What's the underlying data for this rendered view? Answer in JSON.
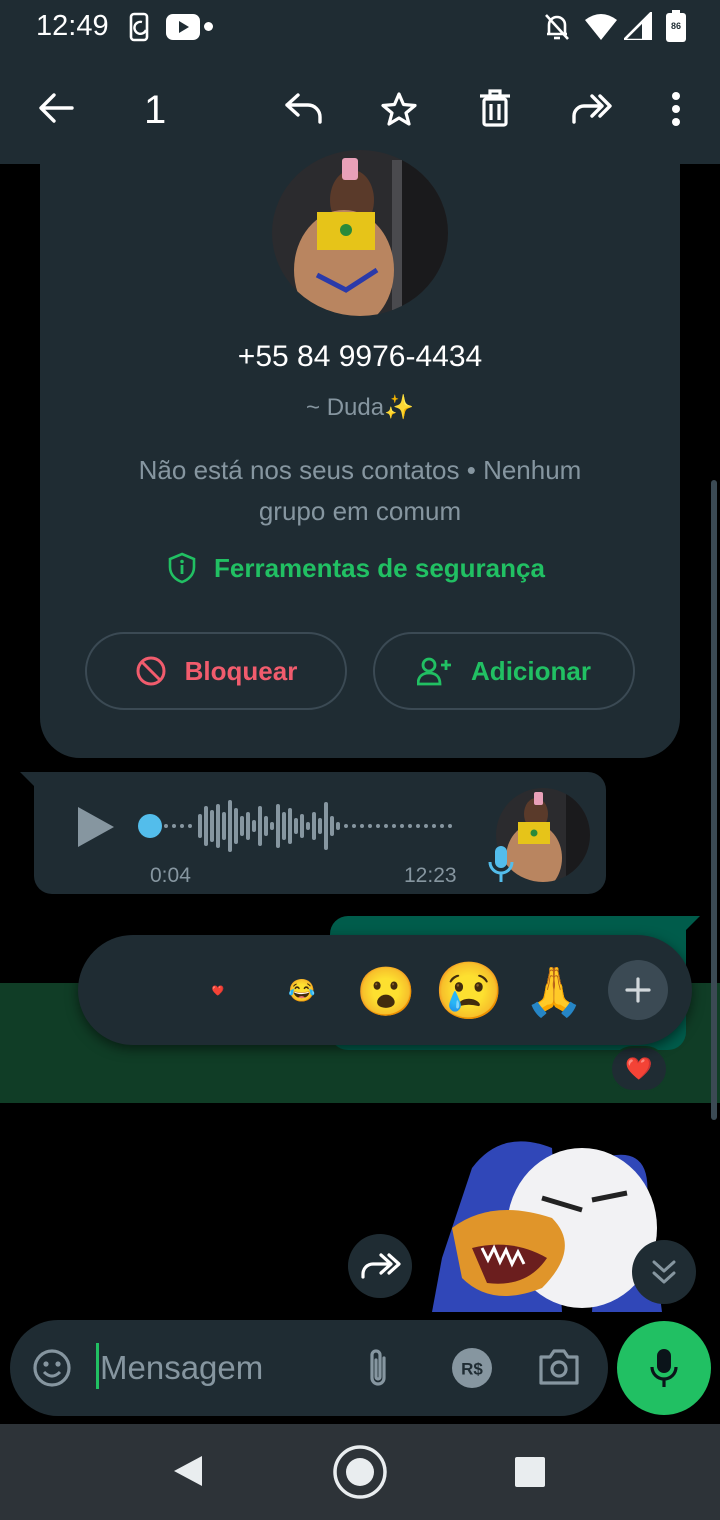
{
  "status_bar": {
    "time": "12:49",
    "battery": "86",
    "icons": [
      "screen-rotate-icon",
      "youtube-icon",
      "notification-dot-icon",
      "mute-icon",
      "wifi-icon",
      "signal-icon",
      "battery-icon"
    ]
  },
  "toolbar": {
    "selected_count": "1",
    "icons": [
      "back-arrow-icon",
      "reply-icon",
      "star-icon",
      "delete-icon",
      "forward-icon",
      "more-vert-icon"
    ]
  },
  "profile": {
    "phone": "+55 84 9976-4434",
    "nickname": "~ Duda✨",
    "info": "Não está nos seus contatos • Nenhum grupo em comum",
    "safety_tools": "Ferramentas de segurança",
    "block_label": "Bloquear",
    "add_label": "Adicionar"
  },
  "voice_message": {
    "duration": "0:04",
    "time": "12:23"
  },
  "reactions": {
    "emojis": [
      "❤️",
      "😂",
      "😮",
      "😢",
      "🙏"
    ],
    "applied": "❤️"
  },
  "input": {
    "placeholder": "Mensagem"
  },
  "colors": {
    "bar_bg": "#1f2c33",
    "accent_green": "#21c063",
    "danger_red": "#f15c6d",
    "selection_band": "#103d26",
    "outgoing_bubble": "#005c4b",
    "nav_bar": "#2d3338"
  }
}
